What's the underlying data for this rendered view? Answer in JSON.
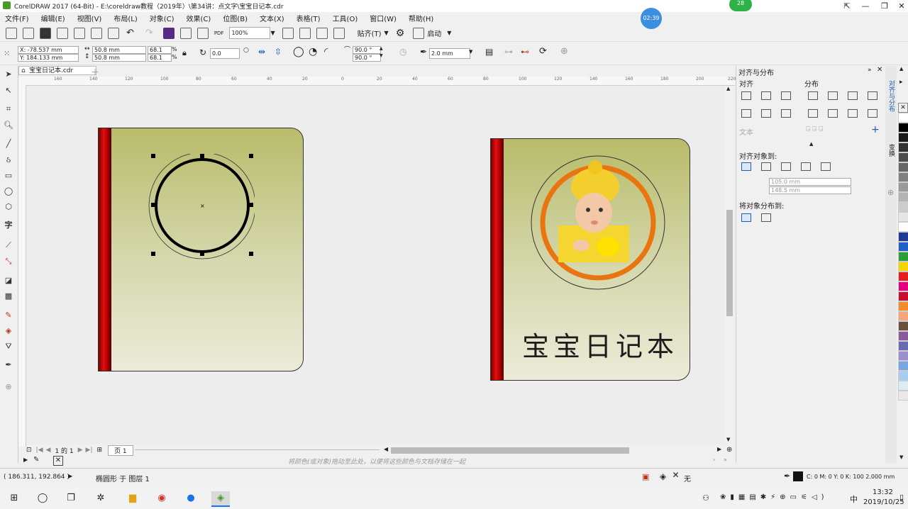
{
  "window": {
    "title": "CorelDRAW 2017 (64-Bit) - E:\\coreldraw教程（2019年）\\第34讲：点文字\\宝宝日记本.cdr"
  },
  "floating_badge": "28",
  "timer_badge": "02:39",
  "menu": [
    "文件(F)",
    "编辑(E)",
    "视图(V)",
    "布局(L)",
    "对象(C)",
    "效果(C)",
    "位图(B)",
    "文本(X)",
    "表格(T)",
    "工具(O)",
    "窗口(W)",
    "帮助(H)"
  ],
  "toolbar": {
    "zoom": "100%",
    "snap_label": "贴齐(T)",
    "launch_label": "启动",
    "pdf_label": "PDF"
  },
  "propbar": {
    "x": "X: -78.537 mm",
    "y": "Y: 184.133 mm",
    "w": "50.8 mm",
    "h": "50.8 mm",
    "sx": "68.1",
    "sy": "68.1",
    "pct": "%",
    "rotation": "0.0",
    "angle1": "90.0 °",
    "angle2": "90.0 °",
    "outline": "2.0 mm"
  },
  "document": {
    "tab": "宝宝日记本.cdr"
  },
  "ruler_ticks": [
    "160",
    "140",
    "120",
    "100",
    "80",
    "60",
    "40",
    "20",
    "0",
    "20",
    "40",
    "60",
    "80",
    "100",
    "120",
    "140",
    "160",
    "180",
    "200",
    "220"
  ],
  "book": {
    "title_text": "宝宝日记本"
  },
  "pages": {
    "label": "1 的 1",
    "page_tab": "页 1"
  },
  "colorbar_hint": "将颜色(或对象)拖动至此处，以便将这些颜色与文档存储在一起",
  "docker": {
    "header": "对齐与分布",
    "align_label": "对齐",
    "distribute_label": "分布",
    "text_label": "文本",
    "align_to_label": "对齐对象到:",
    "x_field": "105.0 mm",
    "y_field": "148.5 mm",
    "distribute_to_label": "将对象分布到:",
    "side_tab1": "对齐与分布",
    "side_tab2": "变换"
  },
  "palette_colors": [
    "#ffffff",
    "#000000",
    "#1a1a1a",
    "#333333",
    "#4d4d4d",
    "#666666",
    "#808080",
    "#999999",
    "#b3b3b3",
    "#cccccc",
    "#e6e6e6",
    "#ffffff",
    "#1f3a93",
    "#1e5fc8",
    "#2a9d3c",
    "#f2d600",
    "#e51e1e",
    "#e5007d",
    "#c8102e",
    "#f28c28",
    "#f4a57b",
    "#6b4f3a",
    "#8b5a9b",
    "#6a6ab0",
    "#9a8fd0",
    "#7aa6e0",
    "#a9cdf0",
    "#d9ecf7",
    "#e9e9e9"
  ],
  "status": {
    "coords": "( 186.311, 192.864 )",
    "object_info": "椭圆形 于 图层 1",
    "fill_none": "无",
    "outline_info": "C: 0 M: 0 Y: 0 K: 100  2.000 mm"
  },
  "taskbar": {
    "time": "13:32",
    "date": "2019/10/25"
  }
}
